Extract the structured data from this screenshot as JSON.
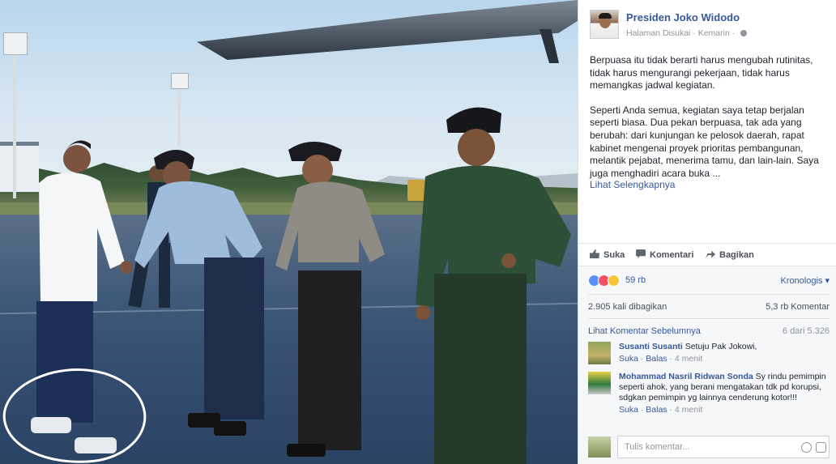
{
  "post": {
    "page_name": "Presiden Joko Widodo",
    "liked_label": "Halaman Disukai",
    "time": "Kemarin",
    "paragraph1": "Berpuasa itu tidak berarti harus mengubah rutinitas, tidak harus mengurangi pekerjaan, tidak harus memangkas jadwal kegiatan.",
    "paragraph2": "Seperti Anda semua, kegiatan saya tetap berjalan seperti biasa. Dua pekan berpuasa, tak ada yang berubah: dari kunjungan ke pelosok daerah, rapat kabinet mengenai proyek prioritas pembangunan, melantik pejabat, menerima tamu, dan lain-lain. Saya juga menghadiri acara buka ...",
    "see_more": "Lihat Selengkapnya"
  },
  "actions": {
    "like": "Suka",
    "comment": "Komentari",
    "share": "Bagikan"
  },
  "feedback": {
    "reaction_count": "59 rb",
    "sort_label": "Kronologis",
    "shares": "2.905 kali dibagikan",
    "comments_total": "5,3 rb Komentar",
    "prev_comments": "Lihat Komentar Sebelumnya",
    "prev_count": "6 dari 5.326"
  },
  "comments": [
    {
      "name": "Susanti Susanti",
      "text": "Setuju Pak Jokowi,",
      "like": "Suka",
      "reply": "Balas",
      "time": "4 menit"
    },
    {
      "name": "Mohammad Nasril Ridwan Sonda",
      "text": "Sy rindu pemimpin seperti ahok, yang berani mengatakan tdk pd korupsi, sdgkan pemimpin yg lainnya cenderung kotor!!!",
      "like": "Suka",
      "reply": "Balas",
      "time": "4 menit"
    }
  ],
  "composer": {
    "placeholder": "Tulis komentar..."
  },
  "colors": {
    "link": "#365899",
    "text": "#1d2129",
    "muted": "#90949c"
  }
}
